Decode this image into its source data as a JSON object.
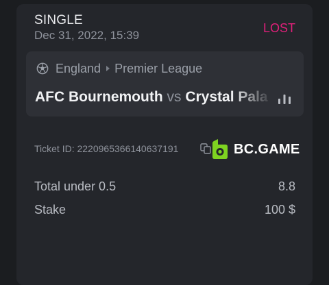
{
  "bet": {
    "type": "SINGLE",
    "date": "Dec 31, 2022, 15:39",
    "status": "LOST",
    "status_color": "#e0207a"
  },
  "event": {
    "sport_icon": "soccer-ball-icon",
    "country": "England",
    "league": "Premier League",
    "home_team": "AFC Bournemouth",
    "vs_label": "vs",
    "away_team": "Crystal Palace",
    "stats_icon": "bar-chart-icon"
  },
  "ticket": {
    "label": "Ticket ID: 2220965366140637191",
    "copy_icon": "copy-icon"
  },
  "brand": {
    "name": "BC.GAME",
    "logo_color": "#7ed321"
  },
  "details": [
    {
      "label": "Total under 0.5",
      "value": "8.8"
    },
    {
      "label": "Stake",
      "value": "100 $"
    }
  ]
}
